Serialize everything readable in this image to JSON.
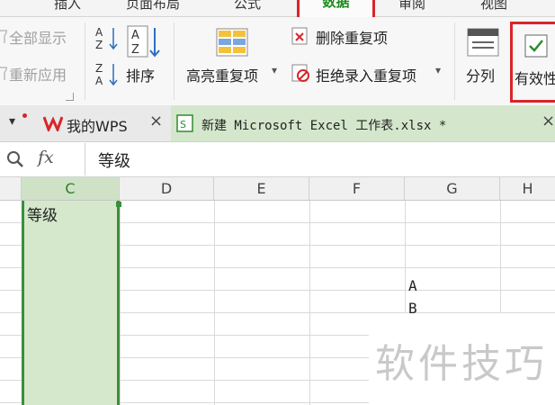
{
  "menu": {
    "tabs": [
      "插入",
      "页面布局",
      "公式",
      "审阅",
      "视图"
    ],
    "active_tab": "数据"
  },
  "ribbon": {
    "show_all": "全部显示",
    "reapply": "重新应用",
    "sort": "排序",
    "highlight_duplicates": "高亮重复项",
    "delete_duplicates": "删除重复项",
    "reject_duplicates": "拒绝录入重复项",
    "split_column": "分列",
    "validity": "有效性"
  },
  "doc_tabs": {
    "wps_tab": "我的WPS",
    "excel_tab": "新建 Microsoft Excel 工作表.xlsx *"
  },
  "formula_bar": {
    "fx": "fx",
    "value": "等级"
  },
  "columns": [
    "C",
    "D",
    "E",
    "F",
    "G",
    "H"
  ],
  "cells": {
    "c1": "等级",
    "g5": "A",
    "g6": "B"
  },
  "watermark": "软件技巧",
  "colors": {
    "accent_red": "#d9252a",
    "active_green": "#1e8a1e",
    "selection_fill": "#d5e8cc",
    "selection_border": "#3b8e3b"
  }
}
